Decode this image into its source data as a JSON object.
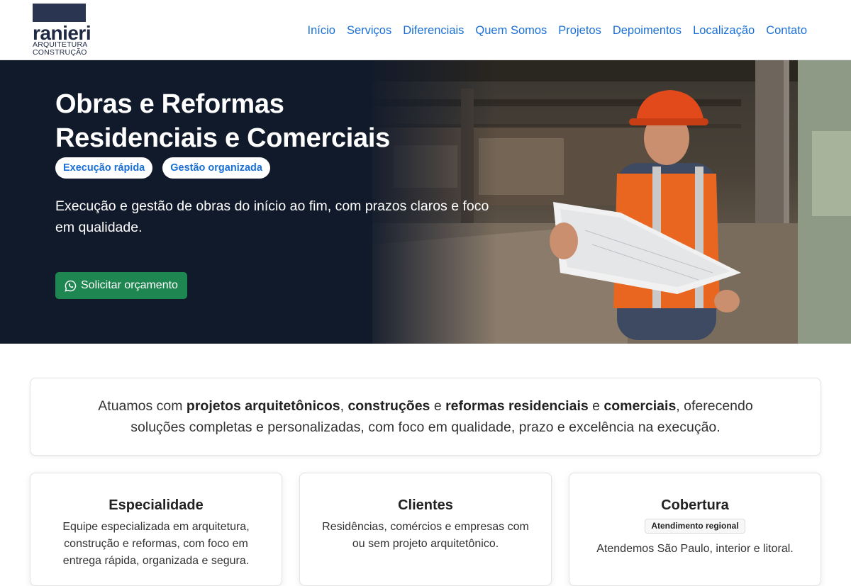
{
  "header": {
    "logo": {
      "name": "ranieri",
      "line1": "ARQUITETURA",
      "line2": "CONSTRUÇÃO"
    },
    "nav": [
      "Início",
      "Serviços",
      "Diferenciais",
      "Quem Somos",
      "Projetos",
      "Depoimentos",
      "Localização",
      "Contato"
    ]
  },
  "hero": {
    "title_line1": "Obras e Reformas",
    "title_line2": "Residenciais e Comerciais",
    "pills": [
      "Execução rápida",
      "Gestão organizada"
    ],
    "subtitle": "Execução e gestão de obras do início ao fim, com prazos claros e foco em qualidade.",
    "cta_label": "Solicitar orçamento",
    "cta_icon": "whatsapp-icon"
  },
  "intro": {
    "t1": "Atuamos com ",
    "b1": "projetos arquitetônicos",
    "t2": ", ",
    "b2": "construções",
    "t3": " e ",
    "b3": "reformas residenciais",
    "t4": " e ",
    "b4": "comerciais",
    "t5": ", oferecendo soluções completas e personalizadas, com foco em qualidade, prazo e excelência na execução."
  },
  "cards": [
    {
      "title": "Especialidade",
      "text": "Equipe especializada em arquitetura, construção e reformas, com foco em entrega rápida, organizada e segura."
    },
    {
      "title": "Clientes",
      "text": "Residências, comércios e empresas com ou sem projeto arquitetônico."
    },
    {
      "title": "Cobertura",
      "badge": "Atendimento regional",
      "text": "Atendemos São Paulo, interior e litoral."
    }
  ],
  "colors": {
    "brand_navy": "#1f2a44",
    "link_blue": "#1a6fd6",
    "cta_green": "#1e8751",
    "hero_bg": "#111a2b"
  }
}
